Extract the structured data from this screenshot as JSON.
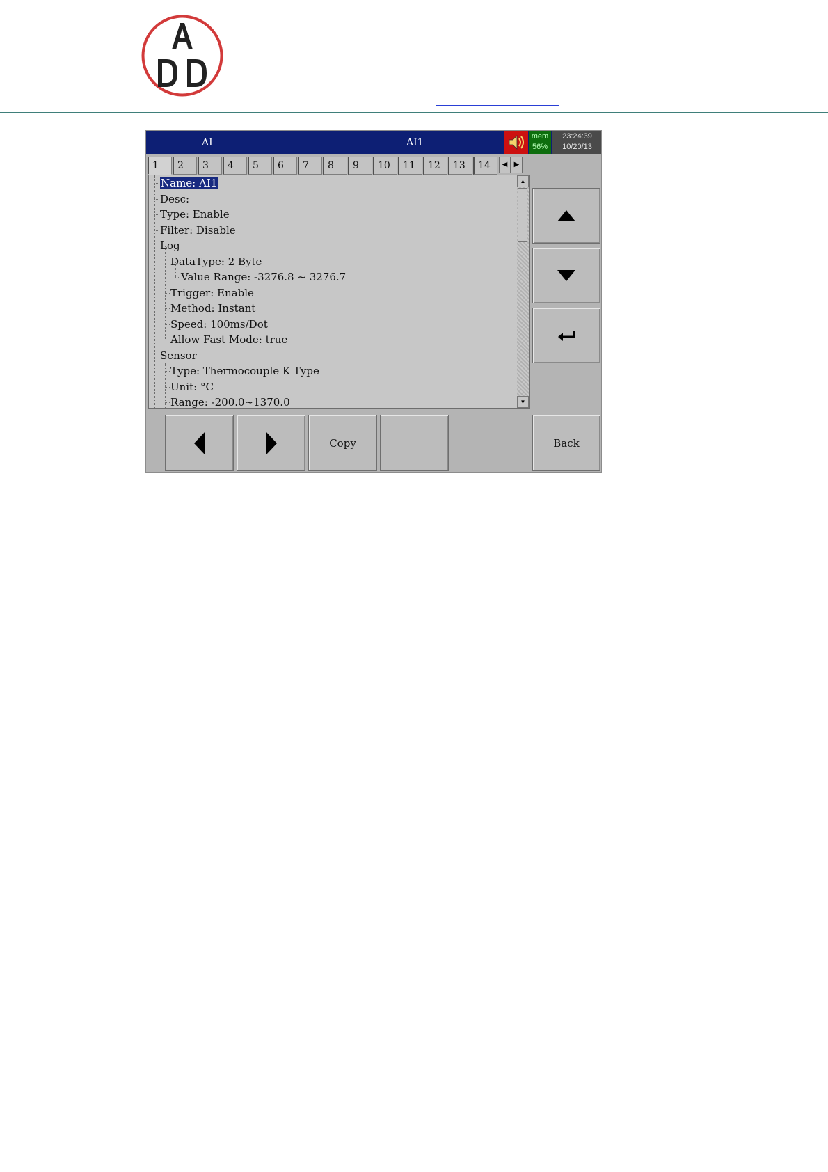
{
  "document": {
    "logo": {
      "letters_top": "A",
      "letters_bottom": "D D",
      "ring_color": "#d23a3a"
    }
  },
  "device": {
    "titlebar": {
      "group": "AI",
      "channel": "AI1",
      "speaker_icon": "speaker-icon",
      "mem_label": "mem",
      "mem_value": "56%",
      "time": "23:24:39",
      "date": "10/20/13",
      "colors": {
        "bar": "#0d1f74",
        "speaker": "#cc1010",
        "mem": "#0e6e0e"
      }
    },
    "tabs": [
      "1",
      "2",
      "3",
      "4",
      "5",
      "6",
      "7",
      "8",
      "9",
      "10",
      "11",
      "12",
      "13",
      "14"
    ],
    "active_tab": "1",
    "tree": [
      {
        "text": "Name: AI1",
        "selected": true
      },
      {
        "text": "Desc:"
      },
      {
        "text": "Type: Enable"
      },
      {
        "text": "Filter: Disable"
      },
      {
        "text": "Log"
      },
      {
        "text": "DataType: 2 Byte"
      },
      {
        "text": "Value Range: -3276.8 ~ 3276.7"
      },
      {
        "text": "Trigger: Enable"
      },
      {
        "text": "Method: Instant"
      },
      {
        "text": "Speed: 100ms/Dot"
      },
      {
        "text": "Allow Fast Mode: true"
      },
      {
        "text": "Sensor"
      },
      {
        "text": "Type: Thermocouple K Type"
      },
      {
        "text": "Unit: °C"
      },
      {
        "text": "Range: -200.0~1370.0"
      }
    ],
    "buttons": {
      "up": "up-arrow-icon",
      "down": "down-arrow-icon",
      "enter": "enter-icon",
      "prev": "left-arrow-icon",
      "next": "right-arrow-icon",
      "copy": "Copy",
      "blank": "",
      "back": "Back"
    }
  }
}
